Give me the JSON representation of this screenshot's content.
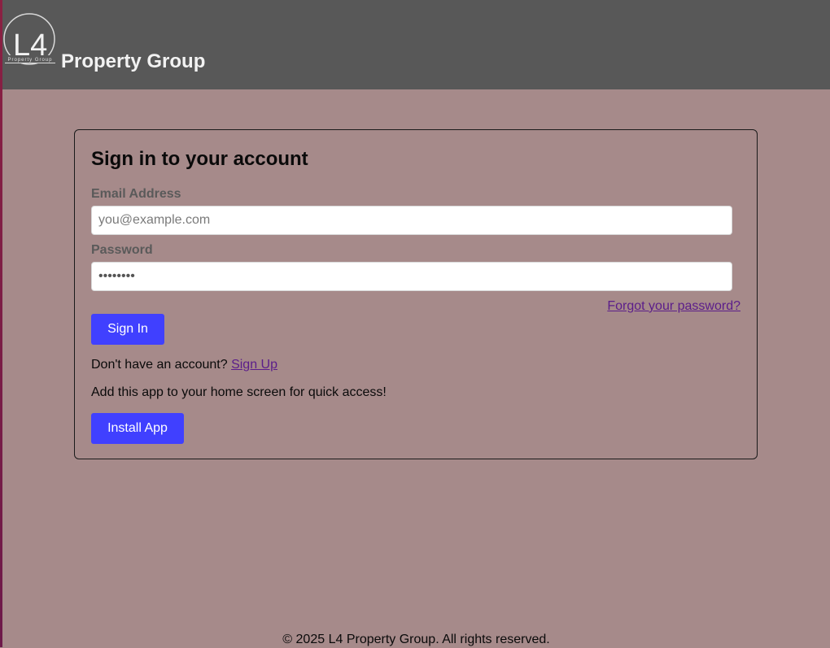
{
  "header": {
    "logo": {
      "mark": "L4",
      "subtext": "Property Group"
    },
    "brand": "Property Group"
  },
  "login_card": {
    "title": "Sign in to your account",
    "email_label": "Email Address",
    "email_placeholder": "you@example.com",
    "email_value": "",
    "password_label": "Password",
    "password_value": "••••••••",
    "forgot_link": "Forgot your password?",
    "signin_button": "Sign In",
    "signup_prompt": "Don't have an account?",
    "signup_link": "Sign Up",
    "install_text": "Add this app to your home screen for quick access!",
    "install_button": "Install App"
  },
  "footer": {
    "copyright": "© 2025 L4 Property Group. All rights reserved."
  },
  "colors": {
    "page_background": "#a68a8a",
    "header_background": "#585858",
    "button": "#4040ff",
    "link": "#5b1d8a"
  }
}
